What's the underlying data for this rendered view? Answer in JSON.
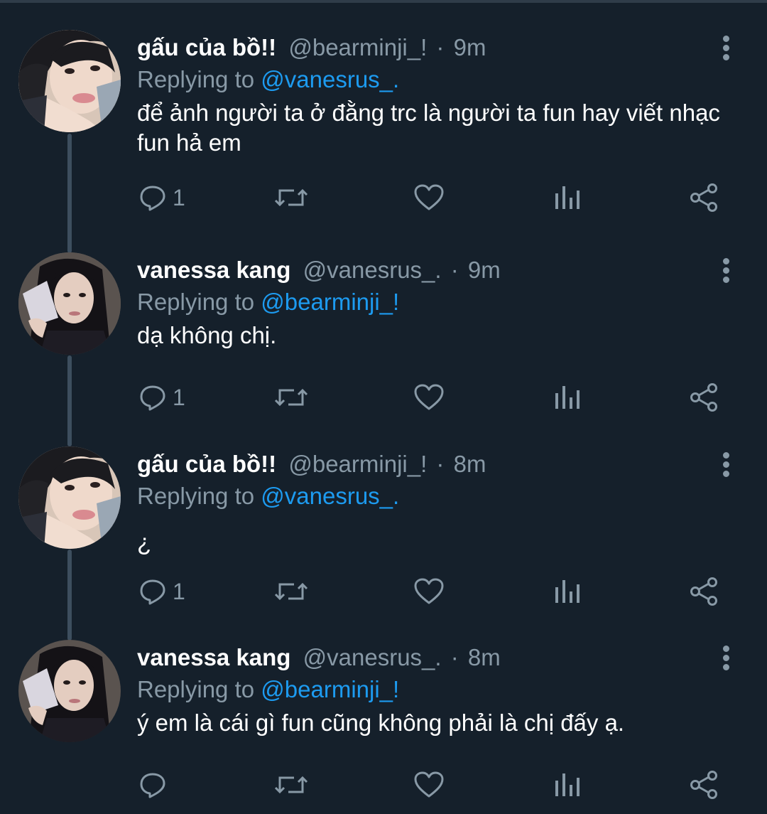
{
  "tweets": [
    {
      "author": "gấu của bồ!!",
      "handle": "@bearminji_!",
      "separator": "·",
      "time": "9m",
      "replying_prefix": "Replying to",
      "replying_to": "@vanesrus_.",
      "text": "để ảnh người ta ở đằng trc là người ta fun hay viết nhạc fun hả em",
      "reply_count": "1"
    },
    {
      "author": "vanessa kang",
      "handle": "@vanesrus_.",
      "separator": "·",
      "time": "9m",
      "replying_prefix": "Replying to",
      "replying_to": "@bearminji_!",
      "text": "dạ không chị.",
      "reply_count": "1"
    },
    {
      "author": "gấu của bồ!!",
      "handle": "@bearminji_!",
      "separator": "·",
      "time": "8m",
      "replying_prefix": "Replying to",
      "replying_to": "@vanesrus_.",
      "text": "¿",
      "reply_count": "1"
    },
    {
      "author": "vanessa kang",
      "handle": "@vanesrus_.",
      "separator": "·",
      "time": "8m",
      "replying_prefix": "Replying to",
      "replying_to": "@bearminji_!",
      "text": "ý em là cái gì fun cũng không phải là chị đấy ạ.",
      "reply_count": ""
    }
  ],
  "icons": {
    "reply": "reply-icon",
    "retweet": "retweet-icon",
    "like": "heart-icon",
    "analytics": "analytics-icon",
    "share": "share-icon",
    "more": "more-options-icon"
  },
  "colors": {
    "background": "#15202b",
    "text_primary": "#ffffff",
    "text_secondary": "#8899a6",
    "link": "#1d9bf0",
    "thread_line": "#3d4e5e"
  }
}
